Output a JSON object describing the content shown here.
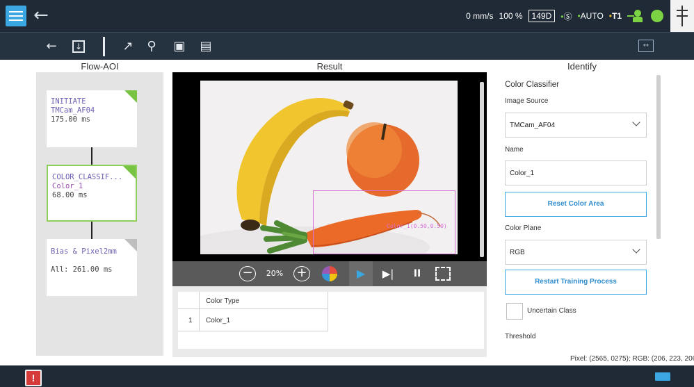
{
  "status": {
    "speed": "0 mm/s",
    "percent": "100 %",
    "project_id": "149D",
    "safety_dot": "•",
    "safety_icon": "Ⓢ",
    "auto_dot": "•",
    "auto_label": "AUTO",
    "t1_dot": "•",
    "t1_label": "T1"
  },
  "panels": {
    "flow_title": "Flow-AOI",
    "result_title": "Result",
    "identify_title": "Identify"
  },
  "flow": {
    "nodes": [
      {
        "line1": "INITIATE",
        "line2": "TMCam_AF04",
        "line3": "175.00 ms"
      },
      {
        "line1": "COLOR_CLASSIF...",
        "line2": "Color_1",
        "line3": "68.00 ms"
      },
      {
        "line1": "Bias & Pixel2mm",
        "line2": "",
        "line3": "All: 261.00 ms"
      }
    ]
  },
  "result": {
    "bbox_label": "Color_1(0.50,0.50)",
    "zoom": "20%",
    "table": {
      "header": "Color Type",
      "rows": [
        {
          "index": "1",
          "value": "Color_1"
        }
      ]
    }
  },
  "identify": {
    "section": "Color Classifier",
    "image_source_label": "Image Source",
    "image_source_value": "TMCam_AF04",
    "name_label": "Name",
    "name_value": "Color_1",
    "reset_btn": "Reset Color Area",
    "color_plane_label": "Color Plane",
    "color_plane_value": "RGB",
    "restart_btn": "Restart Training Process",
    "uncertain_label": "Uncertain Class",
    "threshold_label": "Threshold"
  },
  "pixel_readout": "Pixel: (2565, 0275); RGB: (206, 223, 206);",
  "alarm_glyph": "!",
  "colors": {
    "topbar": "#1f2a36",
    "accent": "#3aa7e2",
    "ok_green": "#7bd344",
    "bbox": "#d66fd6"
  }
}
